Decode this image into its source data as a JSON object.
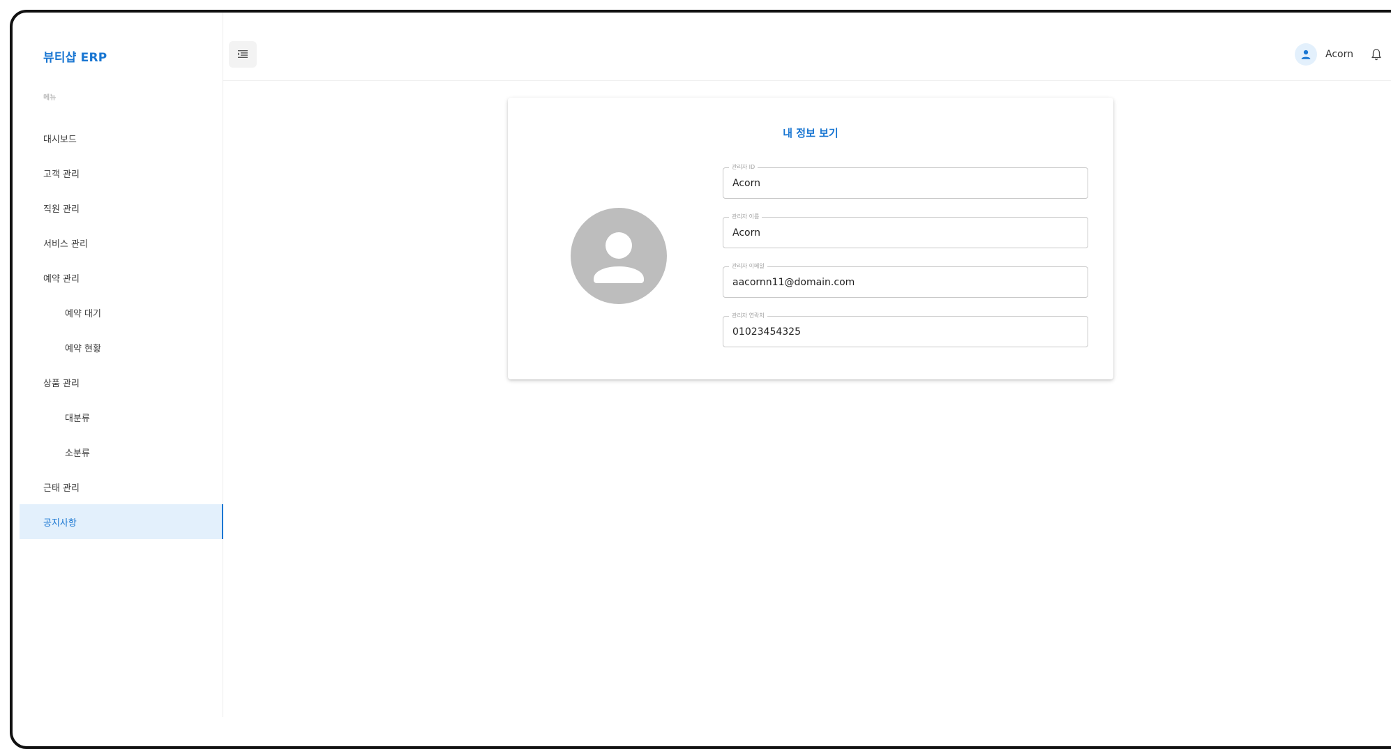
{
  "sidebar": {
    "brand": "뷰티샵 ERP",
    "menu_caption": "메뉴",
    "items": [
      {
        "label": "대시보드"
      },
      {
        "label": "고객 관리"
      },
      {
        "label": "직원 관리"
      },
      {
        "label": "서비스 관리"
      },
      {
        "label": "예약 관리"
      },
      {
        "label": "예약 대기"
      },
      {
        "label": "예약 현황"
      },
      {
        "label": "상품 관리"
      },
      {
        "label": "대분류"
      },
      {
        "label": "소분류"
      },
      {
        "label": "근태 관리"
      },
      {
        "label": "공지사항"
      }
    ],
    "active_item": "공지사항"
  },
  "header": {
    "user_name": "Acorn",
    "icons": [
      "menu-fold-icon",
      "user-icon",
      "bell-icon"
    ]
  },
  "profile": {
    "title": "내 정보 보기",
    "fields": [
      {
        "label": "관리자 ID",
        "value": "Acorn"
      },
      {
        "label": "관리자 이름",
        "value": "Acorn"
      },
      {
        "label": "관리자 이메일",
        "value": "aacornn11@domain.com"
      },
      {
        "label": "관리자 연락처",
        "value": "01023454325"
      }
    ]
  },
  "colors": {
    "accent": "#1976d2",
    "active_bg": "#e3f0fc",
    "avatar_bg": "#bdbdbd"
  }
}
